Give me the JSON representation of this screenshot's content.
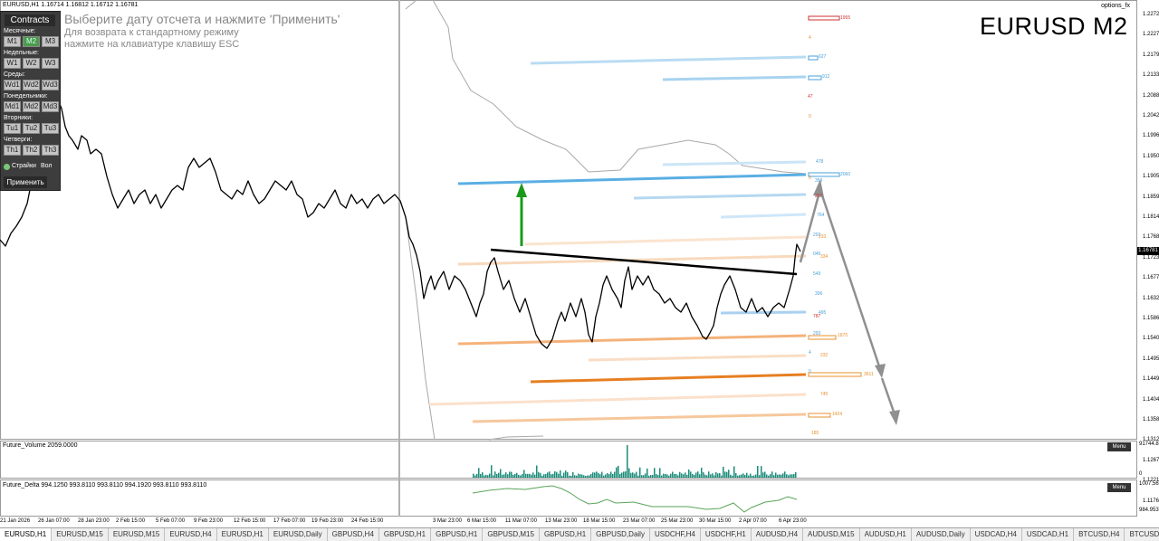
{
  "header": {
    "symbol_line": "EURUSD,H1  1.16714 1.16812 1.16712 1.16781",
    "options_tag": "options_fx",
    "big_title": "EURUSD M2"
  },
  "instructions": {
    "line1": "Выберите дату отсчета и нажмите 'Применить'",
    "line2": "Для возврата к стандартному режиму",
    "line3": "нажмите на клавиатуре клавишу ESC"
  },
  "panel": {
    "title": "Contracts",
    "sections": [
      {
        "label": "Месячные:",
        "buttons": [
          "M1",
          "M2",
          "M3"
        ],
        "active": 1
      },
      {
        "label": "Недельные:",
        "buttons": [
          "W1",
          "W2",
          "W3"
        ],
        "active": -1
      },
      {
        "label": "Среды:",
        "buttons": [
          "Wd1",
          "Wd2",
          "Wd3"
        ],
        "active": -1
      },
      {
        "label": "Понедельники:",
        "buttons": [
          "Md1",
          "Md2",
          "Md3"
        ],
        "active": -1
      },
      {
        "label": "Вторники:",
        "buttons": [
          "Tu1",
          "Tu2",
          "Tu3"
        ],
        "active": -1
      },
      {
        "label": "Четверги:",
        "buttons": [
          "Th1",
          "Th2",
          "Th3"
        ],
        "active": -1
      }
    ],
    "checkbox_label": "Страйки",
    "checkbox_label2": "Вол",
    "apply_label": "Применить"
  },
  "price_axis": {
    "labels": [
      "1.22725",
      "1.22270",
      "1.21795",
      "1.21335",
      "1.20880",
      "1.20425",
      "1.19960",
      "1.19505",
      "1.19050",
      "1.18595",
      "1.18140",
      "1.17685",
      "1.17230",
      "1.16775",
      "1.16320",
      "1.15860",
      "1.15405",
      "1.14950",
      "1.14495",
      "1.14040",
      "1.13585",
      "1.13125",
      "1.12670",
      "1.12215",
      "1.11760"
    ],
    "current": "1.16781"
  },
  "time_axis": [
    "21 Jan 2026",
    "26 Jan 07:00",
    "28 Jan 23:00",
    "2 Feb 15:00",
    "5 Feb 07:00",
    "9 Feb 23:00",
    "12 Feb 15:00",
    "17 Feb 07:00",
    "19 Feb 23:00",
    "24 Feb 15:00",
    "",
    "3 Mar 23:00",
    "6 Mar 15:00",
    "11 Mar 07:00",
    "13 Mar 23:00",
    "18 Mar 15:00",
    "23 Mar 07:00",
    "25 Mar 23:00",
    "30 Mar 15:00",
    "2 Apr 07:00",
    "6 Apr 23:00"
  ],
  "strike_labels": [
    "1955",
    "4",
    "627",
    "912",
    "47",
    "0",
    "478",
    "359",
    "2060",
    "0",
    "207",
    "764",
    "292",
    "233",
    "045",
    "334",
    "549",
    "306",
    "495",
    "787",
    "293",
    "1870",
    "4",
    "232",
    "0",
    "3611",
    "745",
    "1424",
    "185"
  ],
  "volume_panel": {
    "label": "Future_Volume 2059.0000",
    "menu": "Menu",
    "scale_top": "91744.8",
    "scale_bottom": "0"
  },
  "delta_panel": {
    "label": "Future_Delta 994.1250 993.8110 993.8110 994.1920 993.8110 993.8110",
    "menu": "Menu",
    "scale_top": "1007.56",
    "scale_bottom": "984.953"
  },
  "tabs": [
    "EURUSD,H1",
    "EURUSD,M15",
    "EURUSD,M15",
    "EURUSD,H4",
    "EURUSD,H1",
    "EURUSD,Daily",
    "GBPUSD,H4",
    "GBPUSD,H1",
    "GBPUSD,H1",
    "GBPUSD,M15",
    "GBPUSD,H1",
    "GBPUSD,Daily",
    "USDCHF,H4",
    "USDCHF,H1",
    "AUDUSD,H4",
    "AUDUSD,M15",
    "AUDUSD,H1",
    "AUDUSD,Daily",
    "USDCAD,H4",
    "USDCAD,H1",
    "BTCUSD,H4",
    "BTCUSD,Daily",
    "E"
  ],
  "colors": {
    "candle": "#000000",
    "strike_blue": "#4aa0d8",
    "strike_orange": "#e8902e",
    "arrow_green": "#1a9a1a",
    "arrow_gray": "#909090",
    "histogram": "#1a8c7a"
  }
}
